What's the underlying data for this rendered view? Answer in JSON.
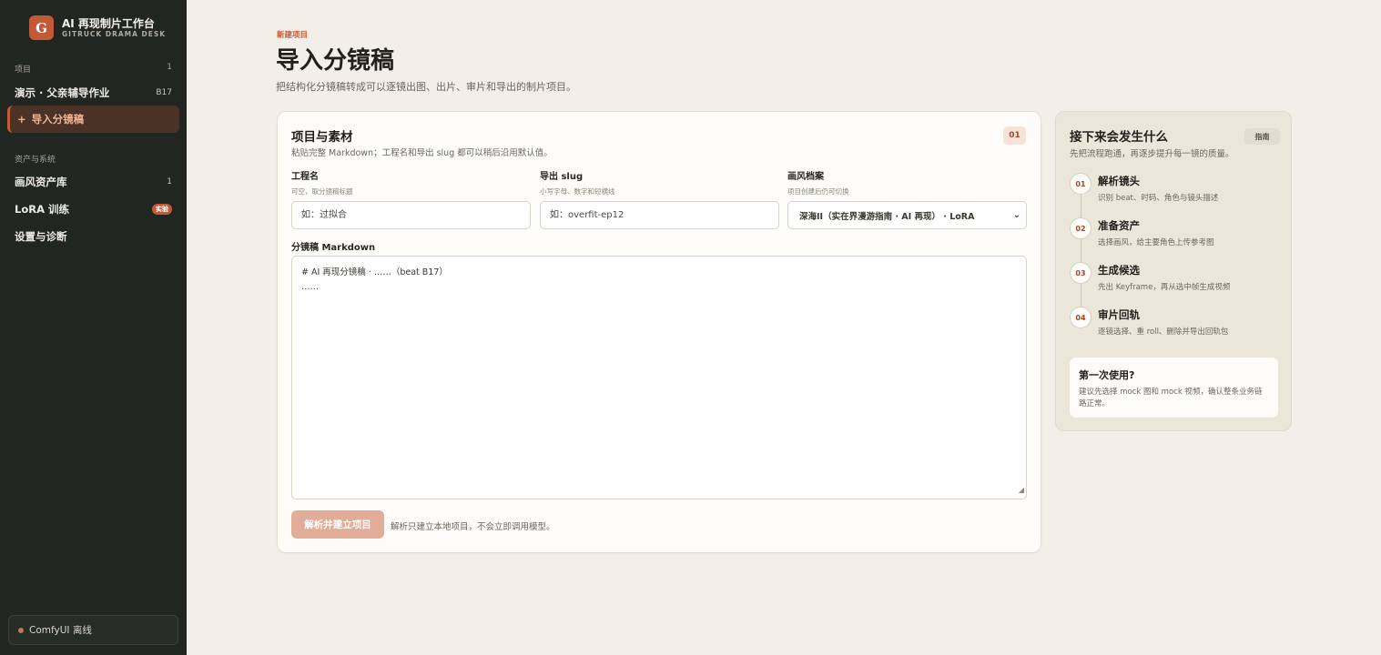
{
  "brand": {
    "logo_letter": "G",
    "title": "AI 再现制片工作台",
    "subtitle": "GITRUCK DRAMA DESK"
  },
  "sidebar": {
    "projects_label": "项目",
    "projects_count": "1",
    "project_item": {
      "label": "演示 · 父亲辅导作业",
      "meta": "B17"
    },
    "active_item": {
      "icon": "+",
      "label": "导入分镜稿"
    },
    "assets_label": "资产与系统",
    "items": [
      {
        "label": "画风资产库",
        "meta": "1"
      },
      {
        "label": "LoRA 训练",
        "badge": "实验"
      },
      {
        "label": "设置与诊断"
      }
    ],
    "status": {
      "label": "ComfyUI 离线",
      "dot_color": "#b87a5c"
    }
  },
  "header": {
    "eyebrow": "新建项目",
    "title": "导入分镜稿",
    "subtitle": "把结构化分镜稿转成可以逐镜出图、出片、审片和导出的制片项目。"
  },
  "form": {
    "title": "项目与素材",
    "subtitle": "粘贴完整 Markdown；工程名和导出 slug 都可以稍后沿用默认值。",
    "step": "01",
    "project_name": {
      "label": "工程名",
      "hint": "可空，取分镜稿标题",
      "placeholder": "如：过拟合"
    },
    "slug": {
      "label": "导出 slug",
      "hint": "小写字母、数字和短横线",
      "placeholder": "如：overfit-ep12"
    },
    "style": {
      "label": "画风档案",
      "hint": "项目创建后仍可切换",
      "value": "深海II（实在界漫游指南 · AI 再现） · LoRA"
    },
    "markdown": {
      "label": "分镜稿 Markdown",
      "line1": "# AI 再现分镜稿 · ……（beat B17）",
      "line2": "……"
    },
    "submit_label": "解析并建立项目",
    "submit_note": "解析只建立本地项目，不会立即调用模型。"
  },
  "guide": {
    "title": "接下来会发生什么",
    "tag": "指南",
    "subtitle": "先把流程跑通，再逐步提升每一镜的质量。",
    "steps": [
      {
        "num": "01",
        "title": "解析镜头",
        "desc": "识别 beat、时码、角色与镜头描述"
      },
      {
        "num": "02",
        "title": "准备资产",
        "desc": "选择画风，给主要角色上传参考图"
      },
      {
        "num": "03",
        "title": "生成候选",
        "desc": "先出 Keyframe，再从选中帧生成视频"
      },
      {
        "num": "04",
        "title": "审片回轨",
        "desc": "逐镜选择、重 roll、删除并导出回轨包"
      }
    ],
    "first_use": {
      "title": "第一次使用?",
      "desc": "建议先选择 mock 图和 mock 视频，确认整条业务链路正常。"
    }
  },
  "colors": {
    "accent": "#c25a37",
    "sidebar_bg": "#222620",
    "page_bg": "#f2efe8"
  }
}
